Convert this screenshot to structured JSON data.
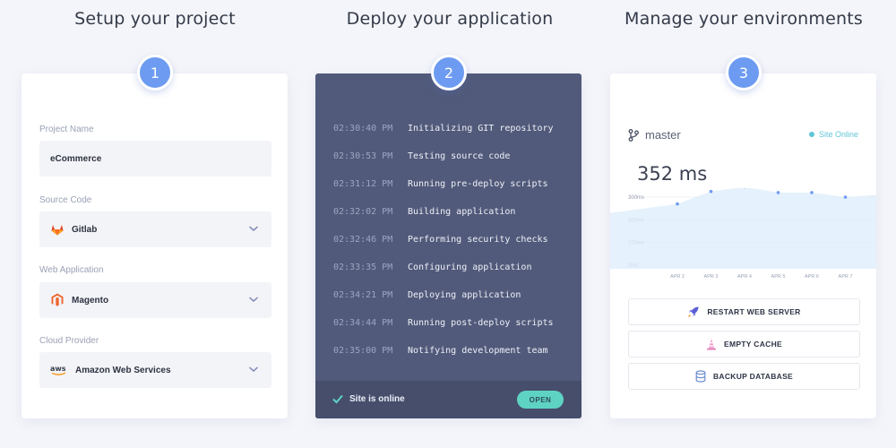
{
  "columns": [
    {
      "title": "Setup your project",
      "step": "1"
    },
    {
      "title": "Deploy your application",
      "step": "2"
    },
    {
      "title": "Manage your environments",
      "step": "3"
    }
  ],
  "setup": {
    "fields": [
      {
        "label": "Project Name",
        "value": "eCommerce",
        "icon": "none"
      },
      {
        "label": "Source Code",
        "value": "Gitlab",
        "icon": "gitlab-icon"
      },
      {
        "label": "Web Application",
        "value": "Magento",
        "icon": "magento-icon"
      },
      {
        "label": "Cloud Provider",
        "value": "Amazon Web Services",
        "icon": "aws-icon"
      }
    ]
  },
  "deploy": {
    "logs": [
      {
        "time": "02:30:40 PM",
        "message": "Initializing GIT repository"
      },
      {
        "time": "02:30:53 PM",
        "message": "Testing source code"
      },
      {
        "time": "02:31:12 PM",
        "message": "Running pre-deploy scripts"
      },
      {
        "time": "02:32:02 PM",
        "message": "Building application"
      },
      {
        "time": "02:32:46 PM",
        "message": "Performing security checks"
      },
      {
        "time": "02:33:35 PM",
        "message": "Configuring application"
      },
      {
        "time": "02:34:21 PM",
        "message": "Deploying application"
      },
      {
        "time": "02:34:44 PM",
        "message": "Running post-deploy scripts"
      },
      {
        "time": "02:35:00 PM",
        "message": "Notifying development team"
      }
    ],
    "status_text": "Site is online",
    "open_label": "OPEN"
  },
  "manage": {
    "branch": "master",
    "site_status": "Site Online",
    "response_time": "352 ms",
    "chart": {
      "y_ticks": [
        "300ms",
        "200ms",
        "100ms",
        "0ms"
      ],
      "x_ticks": [
        "APR 2",
        "APR 3",
        "APR 4",
        "APR 5",
        "APR 6",
        "APR 7"
      ],
      "values": [
        270,
        325,
        345,
        320,
        320,
        300
      ]
    },
    "actions": [
      {
        "label": "RESTART WEB SERVER",
        "icon": "rocket-icon"
      },
      {
        "label": "EMPTY CACHE",
        "icon": "cone-icon"
      },
      {
        "label": "BACKUP DATABASE",
        "icon": "database-icon"
      }
    ]
  },
  "colors": {
    "accent": "#6d9bf1",
    "dark_panel": "#515a7a",
    "teal": "#5fd3c3"
  }
}
